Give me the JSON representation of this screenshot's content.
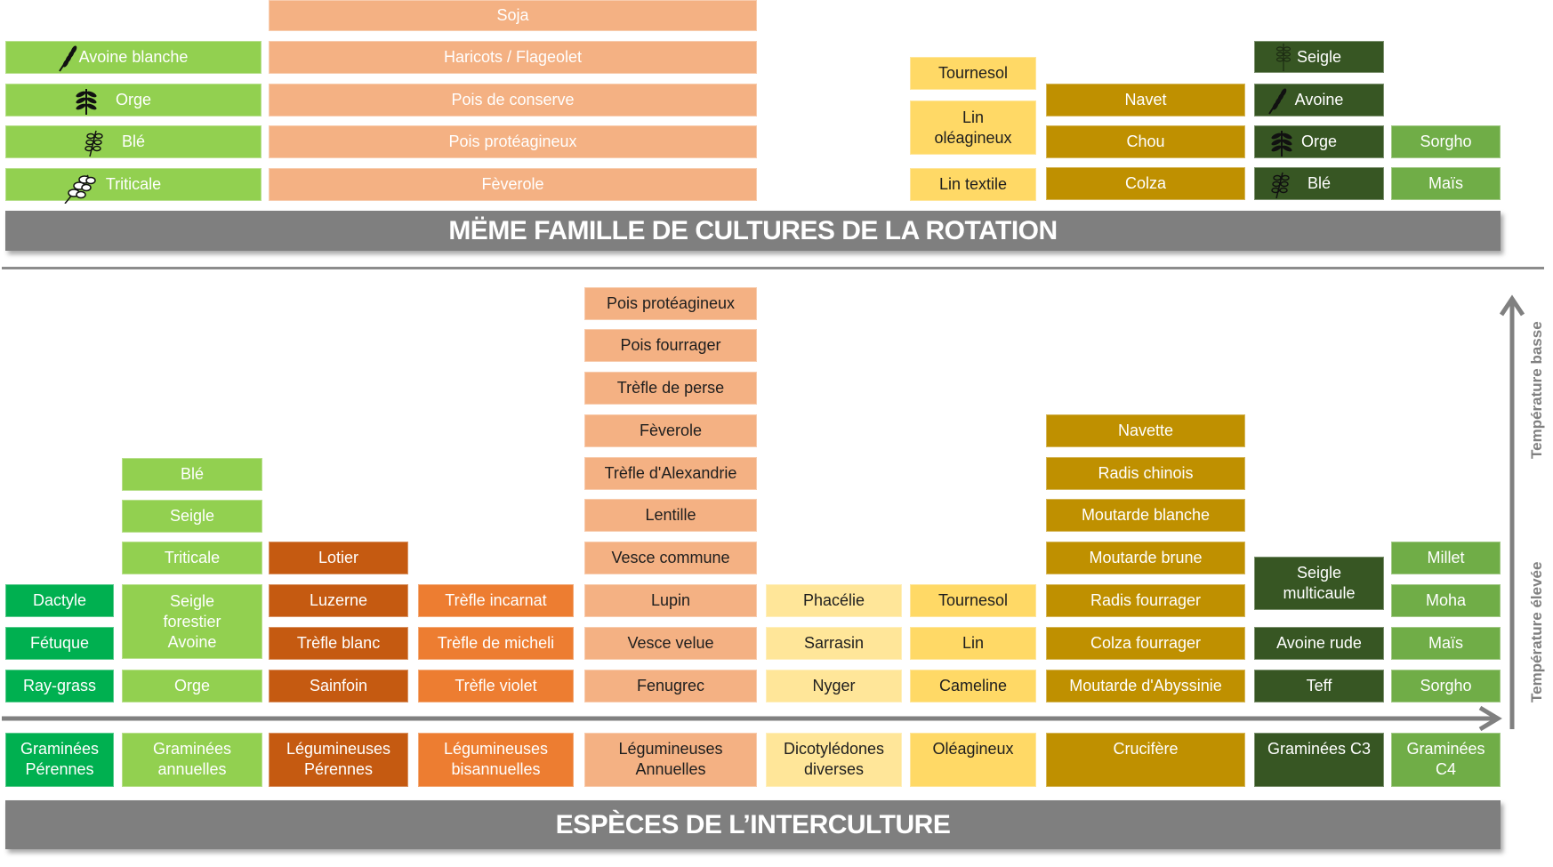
{
  "colors": {
    "graminees_perennes": "#00B050",
    "cereales": "#92D050",
    "legumineuses_perennes": "#C55A11",
    "legumineuses_bisannuelles": "#ED7D31",
    "legumineuses_annuelles": "#F4B183",
    "dicotyledones": "#FFE699",
    "oleagineux": "#FFD966",
    "crucifere": "#BF9000",
    "graminees_c3": "#375623",
    "graminees_c4": "#70AD47",
    "band": "#7F7F7F"
  },
  "top_section": {
    "title": "MËME FAMILLE DE CULTURES DE LA ROTATION",
    "cereales": [
      {
        "label": "Avoine blanche",
        "icon": "oat-icon"
      },
      {
        "label": "Orge",
        "icon": "barley-icon"
      },
      {
        "label": "Blé",
        "icon": "wheat-icon"
      },
      {
        "label": "Triticale",
        "icon": "triticale-icon"
      }
    ],
    "legumineuses": [
      "Soja",
      "Haricots / Flageolet",
      "Pois de conserve",
      "Pois protéagineux",
      "Fèverole"
    ],
    "oleagineux": [
      "Tournesol",
      "Lin oléagineux",
      "Lin textile"
    ],
    "cruciferes": [
      "Navet",
      "Chou",
      "Colza"
    ],
    "graminees_c3": [
      {
        "label": "Seigle",
        "icon": "rye-icon"
      },
      {
        "label": "Avoine",
        "icon": "oat-icon"
      },
      {
        "label": "Orge",
        "icon": "barley-icon"
      },
      {
        "label": "Blé",
        "icon": "wheat-icon"
      }
    ],
    "graminees_c4": [
      "Sorgho",
      "Maïs"
    ]
  },
  "bottom_section": {
    "title": "ESPÈCES DE L’INTERCULTURE",
    "axis_high": "Température basse",
    "axis_low": "Température élevée",
    "categories": [
      "Graminées Pérennes",
      "Graminées annuelles",
      "Légumineuses Pérennes",
      "Légumineuses bisannuelles",
      "Légumineuses Annuelles",
      "Dicotylédones diverses",
      "Oléagineux",
      "Crucifère",
      "Graminées C3",
      "Graminées C4"
    ],
    "graminees_perennes": [
      "Dactyle",
      "Fétuque",
      "Ray-grass"
    ],
    "graminees_annuelles": [
      "Blé",
      "Seigle",
      "Triticale",
      "Seigle forestier Avoine",
      "Orge"
    ],
    "legumineuses_perennes": [
      "Lotier",
      "Luzerne",
      "Trèfle blanc",
      "Sainfoin"
    ],
    "legumineuses_bisannuelles": [
      "Trèfle incarnat",
      "Trèfle de micheli",
      "Trèfle violet"
    ],
    "legumineuses_annuelles": [
      "Pois protéagineux",
      "Pois fourrager",
      "Trèfle de perse",
      "Fèverole",
      "Trèfle d'Alexandrie",
      "Lentille",
      "Vesce commune",
      "Lupin",
      "Vesce velue",
      "Fenugrec"
    ],
    "dicotyledones": [
      "Phacélie",
      "Sarrasin",
      "Nyger"
    ],
    "oleagineux": [
      "Tournesol",
      "Lin",
      "Cameline"
    ],
    "cruciferes": [
      "Navette",
      "Radis chinois",
      "Moutarde blanche",
      "Moutarde brune",
      "Radis fourrager",
      "Colza fourrager",
      "Moutarde d'Abyssinie"
    ],
    "graminees_c3": [
      "Seigle multicaule",
      "Avoine rude",
      "Teff"
    ],
    "graminees_c4": [
      "Millet",
      "Moha",
      "Maïs",
      "Sorgho"
    ]
  }
}
